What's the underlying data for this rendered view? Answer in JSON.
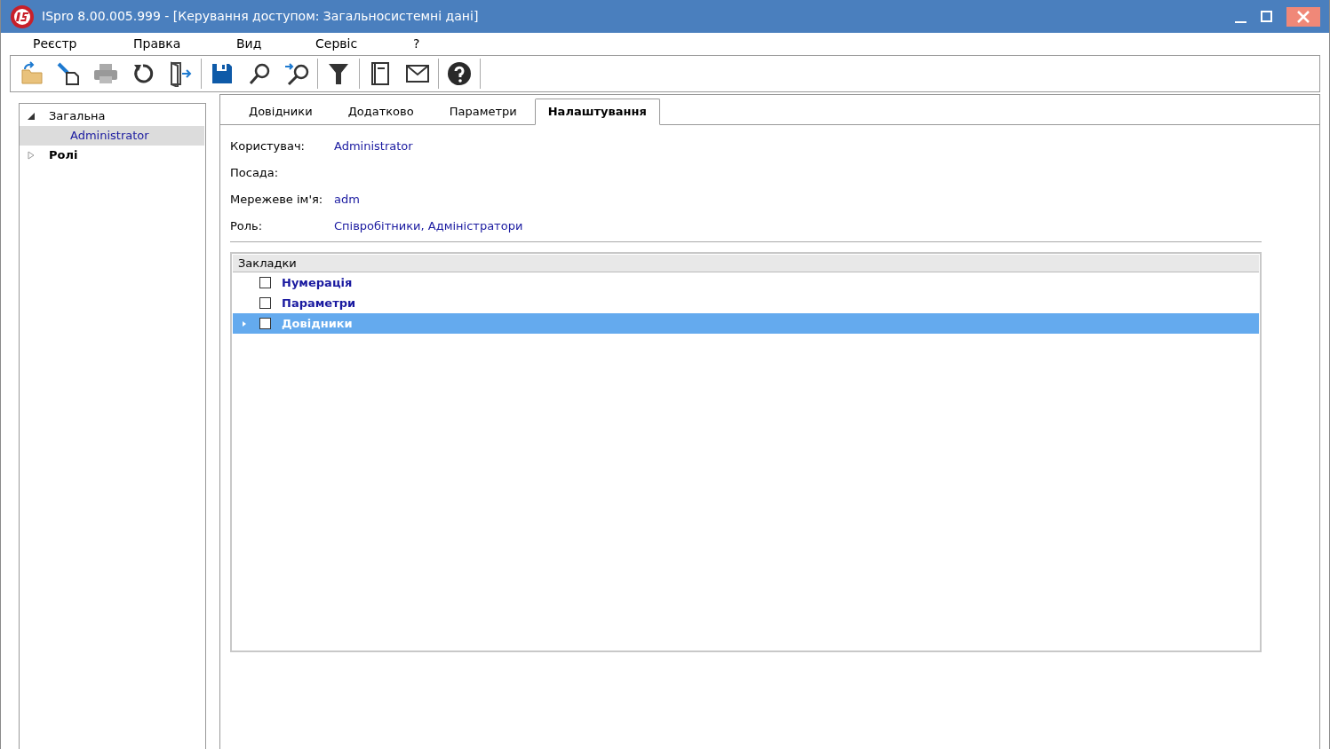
{
  "window": {
    "title": "ISpro 8.00.005.999 - [Керування доступом:  Загальносистемні дані]"
  },
  "menu": [
    "Реєстр",
    "Правка",
    "Вид",
    "Сервіс",
    "?"
  ],
  "tree": [
    {
      "label": "Загальна",
      "expanded": true,
      "bold": false,
      "selected": false,
      "children": [
        {
          "label": "Administrator",
          "selected": true,
          "bold": false
        }
      ]
    },
    {
      "label": "Ролі",
      "expanded": false,
      "bold": true,
      "selected": false
    }
  ],
  "tabs": [
    {
      "label": "Довідники",
      "selected": false
    },
    {
      "label": "Додатково",
      "selected": false
    },
    {
      "label": "Параметри",
      "selected": false
    },
    {
      "label": "Налаштування",
      "selected": true
    }
  ],
  "fields": [
    {
      "label": "Користувач:",
      "value": "Administrator"
    },
    {
      "label": "Посада:"
    },
    {
      "label": "Мережеве ім'я:",
      "value": "adm"
    },
    {
      "label": "Роль:",
      "value": "Співробітники, Адміністратори"
    }
  ],
  "bookmarks": {
    "header": "Закладки",
    "rows": [
      {
        "label": "Нумерація",
        "checked": false,
        "selected": false,
        "kind": "leaf"
      },
      {
        "label": "Параметри",
        "checked": false,
        "selected": false,
        "kind": "leaf"
      },
      {
        "label": "Довідники",
        "checked": false,
        "selected": true,
        "kind": "group"
      }
    ]
  }
}
